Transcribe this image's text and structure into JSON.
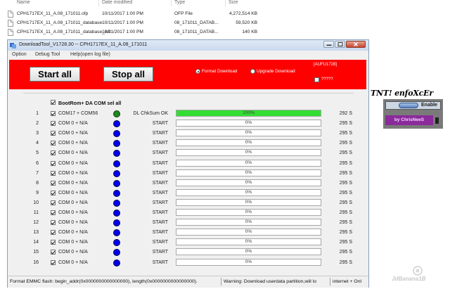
{
  "explorer": {
    "columns": [
      "Name",
      "Date modified",
      "Type",
      "Size"
    ],
    "files": [
      {
        "name": "CPH1717EX_11_A.08_171011.ofp",
        "date": "10/11/2017 1:00 PM",
        "type": "OFP File",
        "size": "4,272,514 KB"
      },
      {
        "name": "CPH1717EX_11_A.08_171011_database",
        "date": "10/11/2017 1:00 PM",
        "type": "08_171011_DATAB...",
        "size": "59,520 KB"
      },
      {
        "name": "CPH1717EX_11_A.08_171011_database_AP",
        "date": "10/11/2017 1:00 PM",
        "type": "08_171011_DATAB...",
        "size": "140 KB"
      }
    ]
  },
  "window": {
    "title": "DownloadTool_V1728.30 -- CPH1717EX_11_A.08_171011",
    "menu": [
      "Option",
      "Debug Tool",
      "Help(open log file)"
    ],
    "start_all": "Start all",
    "stop_all": "Stop all",
    "radio_format": "Format Download",
    "radio_upgrade": "Upgrade Download",
    "format_selected": true,
    "red_label": "[AUFU1728]",
    "red_check_label": "?????",
    "select_all_label": "BootRom+ DA COM sel all",
    "ports": [
      {
        "index": "1",
        "port": "COM17 + COM56",
        "status": "DL ChkSum OK",
        "progress": 1.0,
        "percent": "100%",
        "time": "292 S",
        "color": "green"
      },
      {
        "index": "2",
        "port": "COM 0 + N/A",
        "status": "START",
        "progress": 0,
        "percent": "0%",
        "time": "295 S",
        "color": "blue"
      },
      {
        "index": "3",
        "port": "COM 0 + N/A",
        "status": "START",
        "progress": 0,
        "percent": "0%",
        "time": "295 S",
        "color": "blue"
      },
      {
        "index": "4",
        "port": "COM 0 + N/A",
        "status": "START",
        "progress": 0,
        "percent": "0%",
        "time": "295 S",
        "color": "blue"
      },
      {
        "index": "5",
        "port": "COM 0 + N/A",
        "status": "START",
        "progress": 0,
        "percent": "0%",
        "time": "295 S",
        "color": "blue"
      },
      {
        "index": "6",
        "port": "COM 0 + N/A",
        "status": "START",
        "progress": 0,
        "percent": "0%",
        "time": "295 S",
        "color": "blue"
      },
      {
        "index": "7",
        "port": "COM 0 + N/A",
        "status": "START",
        "progress": 0,
        "percent": "0%",
        "time": "295 S",
        "color": "blue"
      },
      {
        "index": "8",
        "port": "COM 0 + N/A",
        "status": "START",
        "progress": 0,
        "percent": "0%",
        "time": "295 S",
        "color": "blue"
      },
      {
        "index": "9",
        "port": "COM 0 + N/A",
        "status": "START",
        "progress": 0,
        "percent": "0%",
        "time": "295 S",
        "color": "blue"
      },
      {
        "index": "10",
        "port": "COM 0 + N/A",
        "status": "START",
        "progress": 0,
        "percent": "0%",
        "time": "295 S",
        "color": "blue"
      },
      {
        "index": "11",
        "port": "COM 0 + N/A",
        "status": "START",
        "progress": 0,
        "percent": "0%",
        "time": "295 S",
        "color": "blue"
      },
      {
        "index": "12",
        "port": "COM 0 + N/A",
        "status": "START",
        "progress": 0,
        "percent": "0%",
        "time": "295 S",
        "color": "blue"
      },
      {
        "index": "13",
        "port": "COM 0 + N/A",
        "status": "START",
        "progress": 0,
        "percent": "0%",
        "time": "295 S",
        "color": "blue"
      },
      {
        "index": "14",
        "port": "COM 0 + N/A",
        "status": "START",
        "progress": 0,
        "percent": "0%",
        "time": "295 S",
        "color": "blue"
      },
      {
        "index": "15",
        "port": "COM 0 + N/A",
        "status": "START",
        "progress": 0,
        "percent": "0%",
        "time": "295 S",
        "color": "blue"
      },
      {
        "index": "16",
        "port": "COM 0 + N/A",
        "status": "START",
        "progress": 0,
        "percent": "0%",
        "time": "295 S",
        "color": "blue"
      }
    ],
    "status": {
      "left": "Format EMMC flash:  begin_addr(0x0000000000000000), length(0x0000000000000000).",
      "middle": "Warning: Download userdata partition,will lo",
      "right": "internet + Onl"
    }
  },
  "widget": {
    "brand": "TNT! enfoXcEr",
    "enable_label": "Enable",
    "byline": "by ChrisNeeS"
  },
  "watermark": "JdBanana1B",
  "colors": {
    "red_panel": "#ff0000",
    "progress_green": "#33dd33",
    "dot_blue": "#0000ee",
    "dot_green": "#1f8a1f"
  }
}
